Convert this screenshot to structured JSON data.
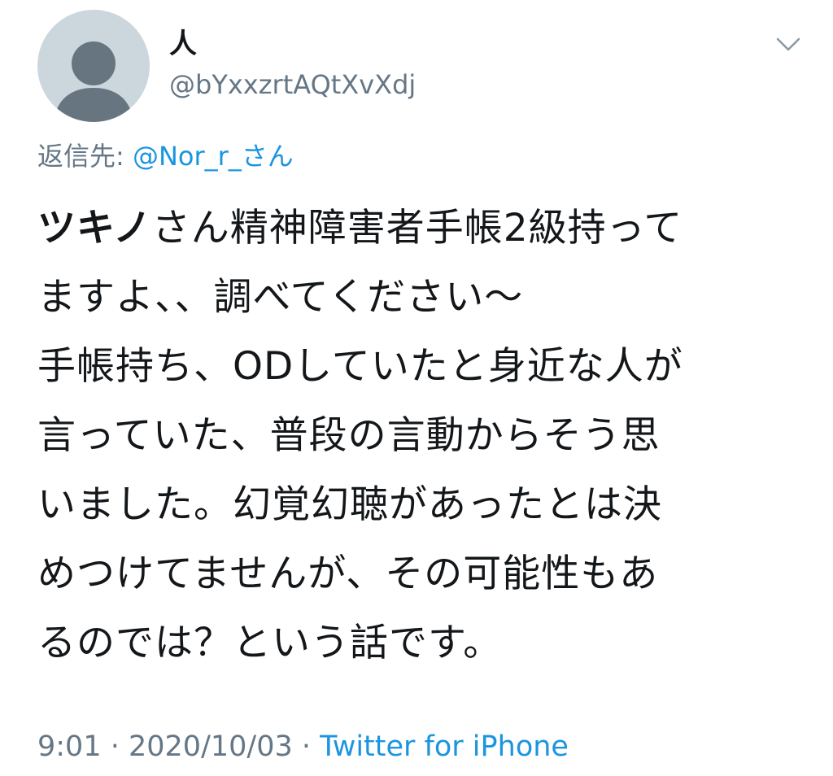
{
  "author": {
    "display_name": "人",
    "handle": "@bYxxzrtAQtXvXdj",
    "avatar_icon": "default-profile-silhouette"
  },
  "menu_icon": "chevron-down-icon",
  "reply": {
    "prefix": "返信先: ",
    "mention": "@Nor_r_さん"
  },
  "tweet": {
    "line1_bold": "ツキノ",
    "line1_rest": "さん精神障害者手帳2級持って",
    "line2": "ますよ、、調べてください〜",
    "line3": "手帳持ち、ODしていたと身近な人が",
    "line4": "言っていた、普段の言動からそう思",
    "line5": "いました。幻覚幻聴があったとは決",
    "line6": "めつけてませんが、その可能性もあ",
    "line7": "るのでは？という話です。"
  },
  "meta": {
    "time": "9:01",
    "separator": " · ",
    "date": "2020/10/03",
    "source": "Twitter for iPhone"
  },
  "colors": {
    "text_primary": "#14171a",
    "text_secondary": "#657786",
    "link": "#1b95e0",
    "avatar_bg": "#ccd6dd",
    "avatar_fg": "#6e7b86"
  }
}
